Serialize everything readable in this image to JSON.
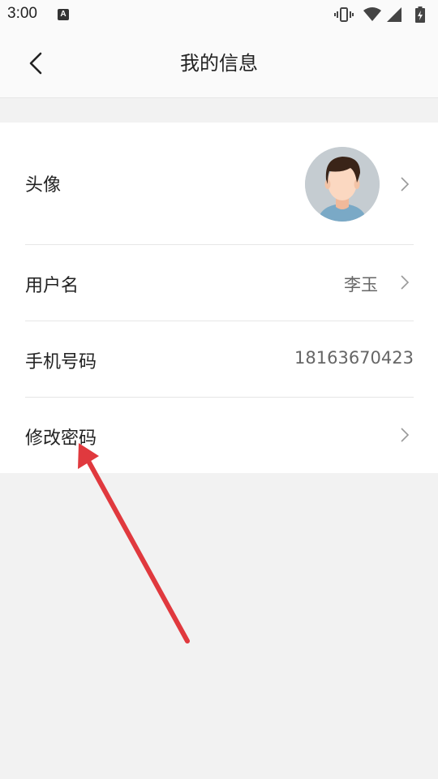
{
  "status_bar": {
    "time": "3:00",
    "a_badge": "A",
    "icons": [
      "vibrate-icon",
      "wifi-icon",
      "signal-icon",
      "battery-charging-icon"
    ]
  },
  "header": {
    "title": "我的信息",
    "back_icon": "chevron-left-icon"
  },
  "rows": {
    "avatar": {
      "label": "头像"
    },
    "username": {
      "label": "用户名",
      "value": "李玉"
    },
    "phone": {
      "label": "手机号码",
      "value": "18163670423"
    },
    "password": {
      "label": "修改密码"
    }
  },
  "colors": {
    "background": "#f2f2f2",
    "card": "#ffffff",
    "annotation_arrow": "#e0393e"
  }
}
